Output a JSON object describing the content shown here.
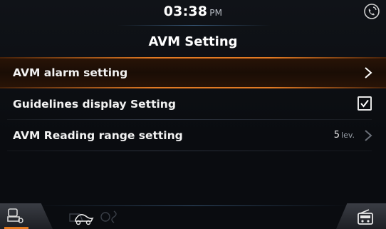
{
  "status_bar": {
    "time": "03:38",
    "ampm": "PM"
  },
  "page": {
    "title": "AVM Setting"
  },
  "menu": {
    "items": [
      {
        "label": "AVM alarm setting"
      },
      {
        "label": "Guidelines display Setting"
      },
      {
        "label": "AVM Reading range setting",
        "value": "5",
        "unit": "lev."
      }
    ]
  },
  "colors": {
    "accent": "#e27a23",
    "background": "#0a0c10",
    "text": "#ffffff"
  },
  "icons": {
    "status": "phone-connection-icon",
    "bottom_left": "vehicle-settings-icon",
    "bottom_center": "eco-icons",
    "bottom_right": "radio-icon"
  }
}
